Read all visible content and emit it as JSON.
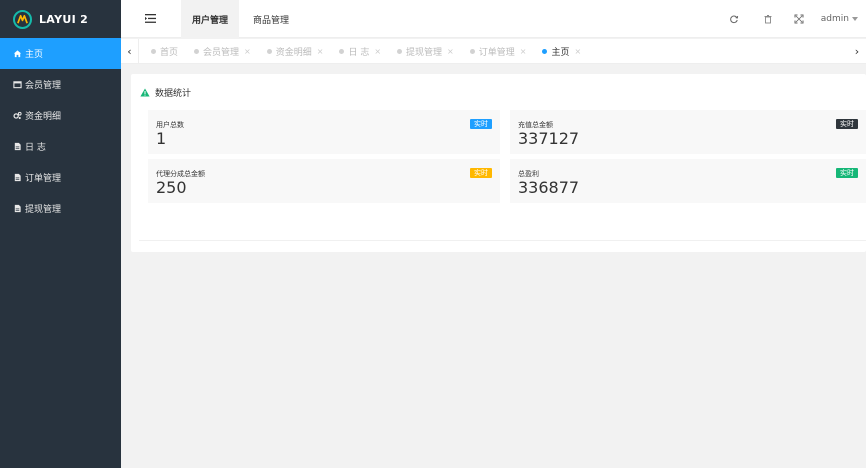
{
  "app": {
    "logo_text": "LAYUI 2"
  },
  "header": {
    "tabs": [
      {
        "label": "用户管理",
        "active": true
      },
      {
        "label": "商品管理",
        "active": false
      }
    ],
    "user": "admin"
  },
  "sidebar": {
    "items": [
      {
        "label": "主页",
        "icon": "home-icon",
        "active": true
      },
      {
        "label": "会员管理",
        "icon": "window-icon",
        "active": false
      },
      {
        "label": "资金明细",
        "icon": "gears-icon",
        "active": false
      },
      {
        "label": "日 志",
        "icon": "file-icon",
        "active": false
      },
      {
        "label": "订单管理",
        "icon": "file-icon",
        "active": false
      },
      {
        "label": "提现管理",
        "icon": "file-icon",
        "active": false
      }
    ]
  },
  "tabbar": {
    "tabs": [
      {
        "label": "首页",
        "closable": false,
        "active": false
      },
      {
        "label": "会员管理",
        "closable": true,
        "active": false
      },
      {
        "label": "资金明细",
        "closable": true,
        "active": false
      },
      {
        "label": "日 志",
        "closable": true,
        "active": false
      },
      {
        "label": "提现管理",
        "closable": true,
        "active": false
      },
      {
        "label": "订单管理",
        "closable": true,
        "active": false
      },
      {
        "label": "主页",
        "closable": true,
        "active": true
      }
    ],
    "close_glyph": "×"
  },
  "stats": {
    "title": "数据统计",
    "cards": [
      {
        "label": "用户总数",
        "value": "1",
        "badge": "实时",
        "badge_color": "#1e9fff"
      },
      {
        "label": "充值总金额",
        "value": "337127",
        "badge": "实时",
        "badge_color": "#2f363c"
      },
      {
        "label": "代理分成总金额",
        "value": "250",
        "badge": "实时",
        "badge_color": "#ffb800"
      },
      {
        "label": "总盈利",
        "value": "336877",
        "badge": "实时",
        "badge_color": "#16b777"
      }
    ]
  },
  "colors": {
    "sidebar_bg": "#28333e",
    "accent": "#1e9fff",
    "logo_accent": "#16baaa"
  }
}
